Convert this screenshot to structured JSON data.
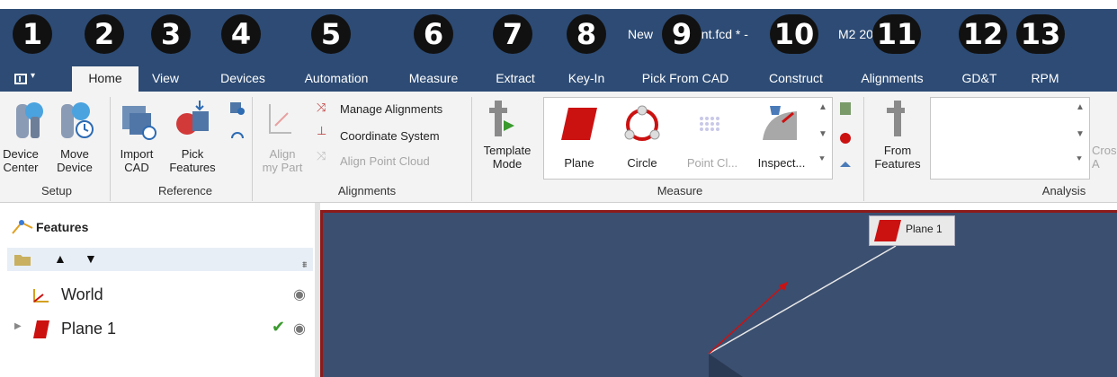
{
  "window": {
    "title_left": "New",
    "title_mid": "ent.fcd * -",
    "title_right": "M2 20"
  },
  "app_menu": {
    "icon": "app-menu-icon",
    "arrow": "▾"
  },
  "tabs": [
    {
      "label": "Home",
      "active": true
    },
    {
      "label": "View"
    },
    {
      "label": "Devices"
    },
    {
      "label": "Automation"
    },
    {
      "label": "Measure"
    },
    {
      "label": "Extract"
    },
    {
      "label": "Key-In"
    },
    {
      "label": "Pick From CAD"
    },
    {
      "label": "Construct"
    },
    {
      "label": "Alignments"
    },
    {
      "label": "GD&T"
    },
    {
      "label": "RPM"
    }
  ],
  "badges": [
    "1",
    "2",
    "3",
    "4",
    "5",
    "6",
    "7",
    "8",
    "9",
    "10",
    "11",
    "12",
    "13"
  ],
  "ribbon": {
    "setup": {
      "label": "Setup",
      "device_center": "Device\nCenter",
      "move_device": "Move\nDevice"
    },
    "reference": {
      "label": "Reference",
      "import_cad": "Import\nCAD",
      "pick_features": "Pick\nFeatures"
    },
    "alignments": {
      "label": "Alignments",
      "align_my_part": "Align\nmy Part",
      "manage_alignments": "Manage Alignments",
      "coordinate_system": "Coordinate System",
      "align_point_cloud": "Align Point Cloud"
    },
    "measure": {
      "label": "Measure",
      "template_mode": "Template\nMode",
      "plane": "Plane",
      "circle": "Circle",
      "point_cloud": "Point Cl...",
      "inspect": "Inspect..."
    },
    "analysis": {
      "label": "Analysis",
      "from_features": "From\nFeatures",
      "cross_cut": "Cros\nA"
    }
  },
  "panel": {
    "title": "Features",
    "tree": [
      {
        "label": "World"
      },
      {
        "label": "Plane 1",
        "status": "✔"
      }
    ]
  },
  "viewport": {
    "tag_label": "Plane 1"
  },
  "colors": {
    "titlebar": "#2d4b74",
    "ribbon": "#f3f3f3",
    "viewport": "#3b4f70",
    "plane_red": "#cc1111",
    "check_green": "#3a9a2e"
  }
}
